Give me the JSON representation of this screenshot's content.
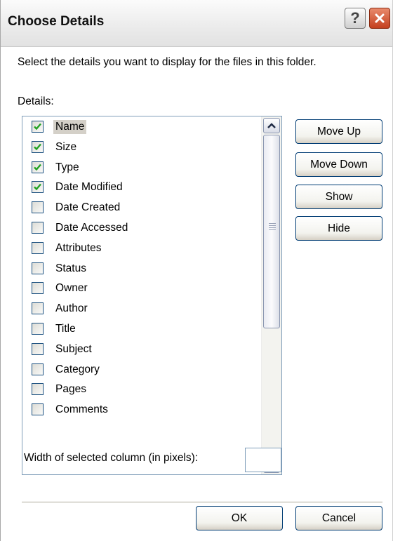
{
  "window": {
    "title": "Choose Details",
    "help_symbol": "?"
  },
  "instruction": "Select the details you want to display for the files in this folder.",
  "details_label": "Details:",
  "details_list": [
    {
      "label": "Name",
      "checked": true,
      "selected": true
    },
    {
      "label": "Size",
      "checked": true,
      "selected": false
    },
    {
      "label": "Type",
      "checked": true,
      "selected": false
    },
    {
      "label": "Date Modified",
      "checked": true,
      "selected": false
    },
    {
      "label": "Date Created",
      "checked": false,
      "selected": false
    },
    {
      "label": "Date Accessed",
      "checked": false,
      "selected": false
    },
    {
      "label": "Attributes",
      "checked": false,
      "selected": false
    },
    {
      "label": "Status",
      "checked": false,
      "selected": false
    },
    {
      "label": "Owner",
      "checked": false,
      "selected": false
    },
    {
      "label": "Author",
      "checked": false,
      "selected": false
    },
    {
      "label": "Title",
      "checked": false,
      "selected": false
    },
    {
      "label": "Subject",
      "checked": false,
      "selected": false
    },
    {
      "label": "Category",
      "checked": false,
      "selected": false
    },
    {
      "label": "Pages",
      "checked": false,
      "selected": false
    },
    {
      "label": "Comments",
      "checked": false,
      "selected": false
    }
  ],
  "side_buttons": {
    "move_up": "Move Up",
    "move_down": "Move Down",
    "show": "Show",
    "hide": "Hide"
  },
  "width_field": {
    "label": "Width of selected column (in pixels):",
    "value": ""
  },
  "footer": {
    "ok": "OK",
    "cancel": "Cancel"
  },
  "colors": {
    "check": "#21a121",
    "selection": "#d4d0c8",
    "close": "#c4401f"
  }
}
